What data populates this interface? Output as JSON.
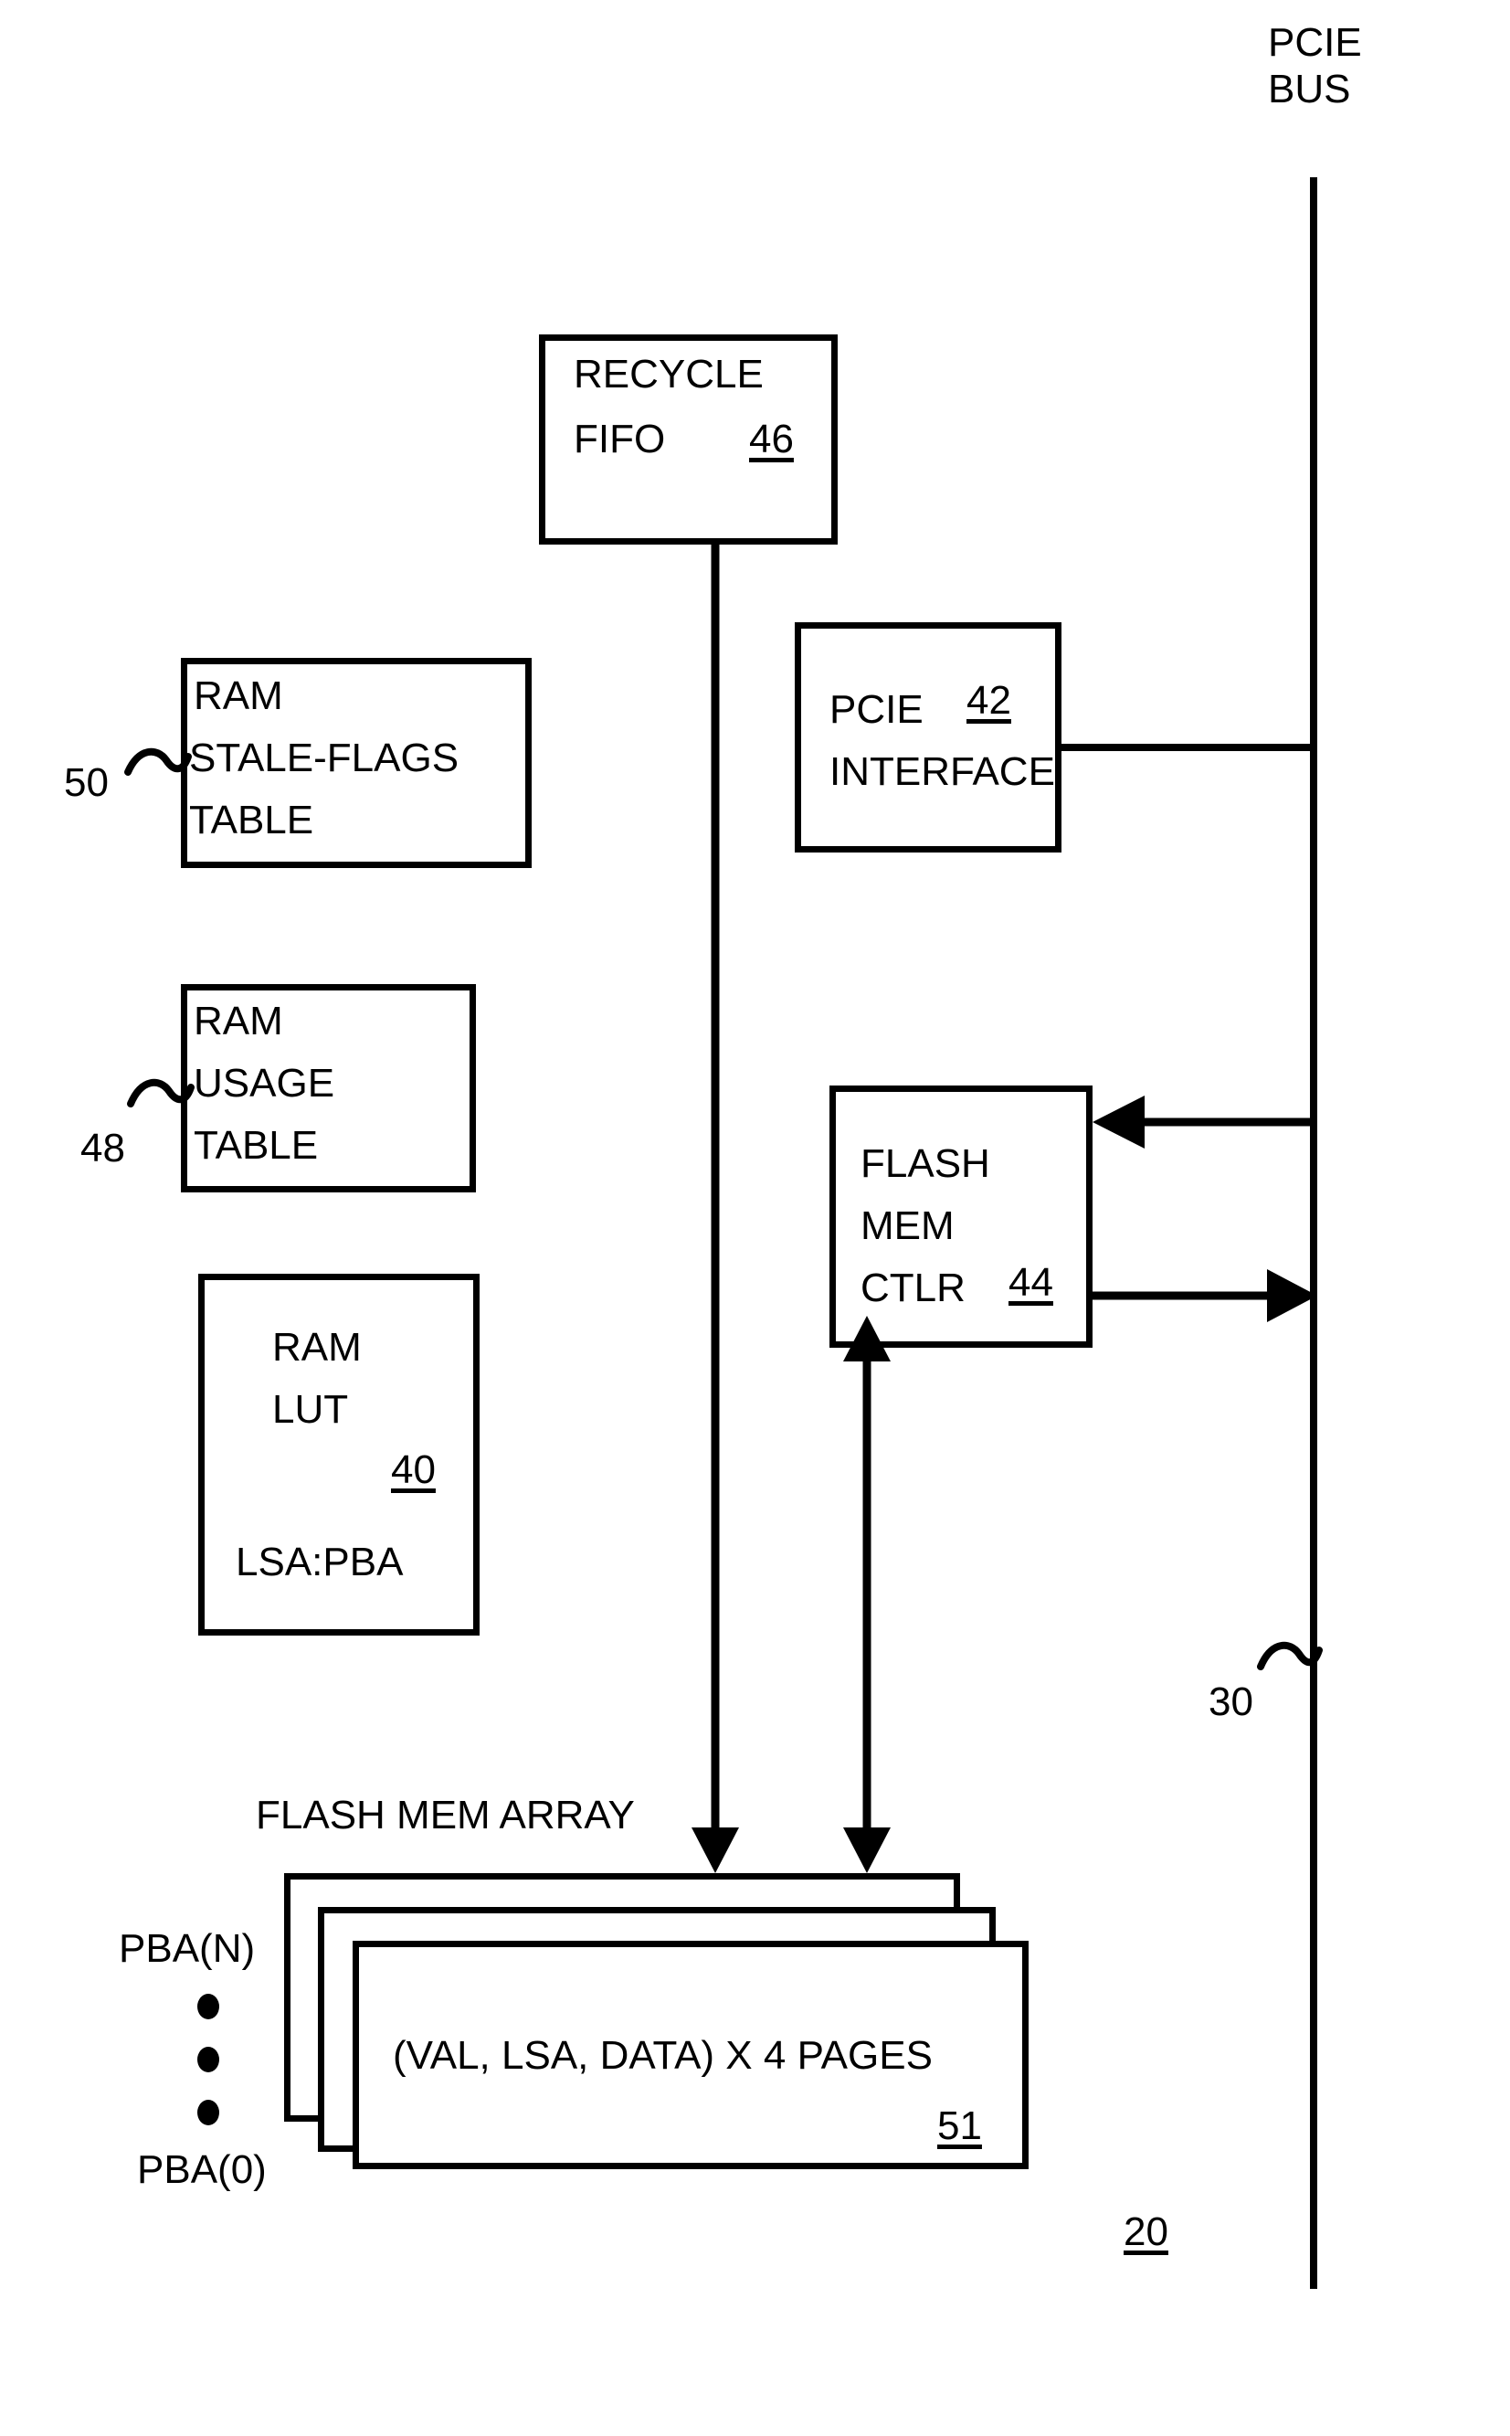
{
  "figure": {
    "bus_label_line1": "PCIE",
    "bus_label_line2": "BUS",
    "bus_ref": "30",
    "system_ref": "20",
    "array_title": "FLASH MEM ARRAY",
    "pba_top": "PBA(N)",
    "pba_bottom": "PBA(0)"
  },
  "blocks": {
    "recycle_fifo": {
      "line1": "RECYCLE",
      "line2": "FIFO",
      "ref": "46"
    },
    "pcie_interface": {
      "line1": "PCIE",
      "line2": "INTERFACE",
      "ref": "42"
    },
    "stale_flags": {
      "line1": "RAM",
      "line2": "STALE-FLAGS",
      "line3": "TABLE",
      "ref": "50"
    },
    "usage_table": {
      "line1": "RAM",
      "line2": "USAGE",
      "line3": "TABLE",
      "ref": "48"
    },
    "ram_lut": {
      "line1": "RAM",
      "line2": "LUT",
      "ref": "40",
      "line3": "LSA:PBA"
    },
    "flash_ctlr": {
      "line1": "FLASH",
      "line2": "MEM",
      "line3": "CTLR",
      "ref": "44"
    },
    "flash_page": {
      "text": "(VAL, LSA, DATA) X 4 PAGES",
      "ref": "51"
    }
  },
  "colors": {
    "stroke": "#000000",
    "background": "#ffffff"
  }
}
